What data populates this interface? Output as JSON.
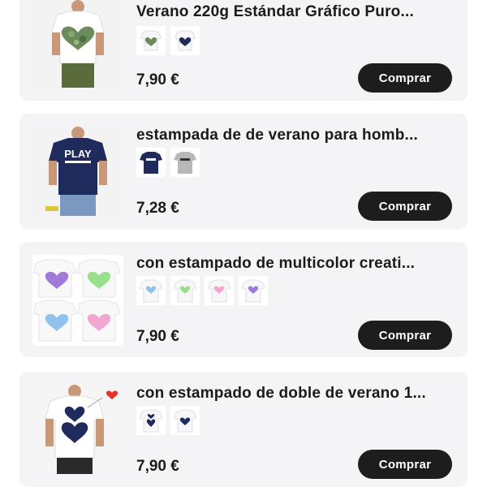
{
  "products": [
    {
      "title": "Verano 220g Estándar Gráfico Puro...",
      "price": "7,90 €",
      "buy_label": "Comprar",
      "thumbnail_icon": "camo-heart-tshirt-icon",
      "variants": [
        "camo-heart-variant-icon",
        "navy-dot-heart-variant-icon"
      ]
    },
    {
      "title": "estampada de de verano para homb...",
      "price": "7,28 €",
      "buy_label": "Comprar",
      "thumbnail_icon": "play-navy-tshirt-icon",
      "variants": [
        "navy-play-variant-icon",
        "grey-play-variant-icon"
      ]
    },
    {
      "title": "con estampado de multicolor creati...",
      "price": "7,90 €",
      "buy_label": "Comprar",
      "thumbnail_icon": "multicolor-hearts-tshirts-icon",
      "variants": [
        "blue-heart-variant-icon",
        "green-heart-variant-icon",
        "pink-heart-variant-icon",
        "purple-heart-variant-icon"
      ]
    },
    {
      "title": "con estampado de doble de verano 1...",
      "price": "7,90 €",
      "buy_label": "Comprar",
      "thumbnail_icon": "double-dot-heart-tshirt-icon",
      "variants": [
        "double-heart-variant-icon",
        "dot-heart-variant-icon"
      ]
    }
  ],
  "colors": {
    "card_bg": "#f4f4f6",
    "button_bg": "#1d1d1d",
    "button_text": "#ffffff",
    "text": "#1b1b1b"
  }
}
